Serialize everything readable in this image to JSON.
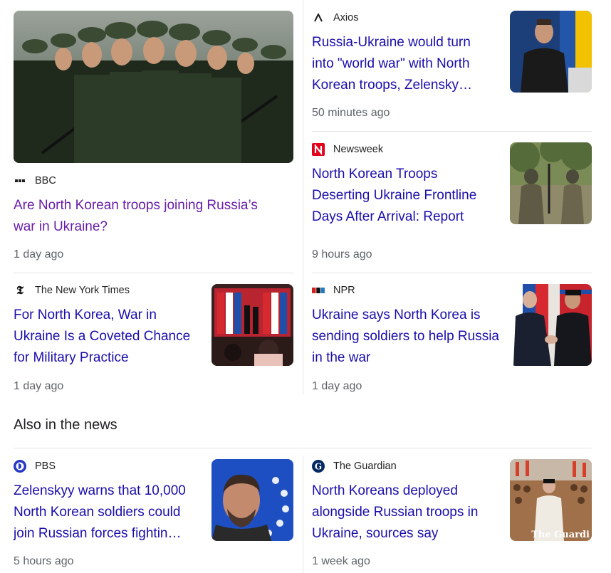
{
  "stories": [
    {
      "source": "BBC",
      "source_icon": "bbc-dots-icon",
      "headline": "Are North Korean troops joining Russia’s war in Ukraine?",
      "time": "1 day ago",
      "image": "soldiers-parade-image"
    },
    {
      "source": "Axios",
      "source_icon": "axios-logo-icon",
      "headline": "Russia-Ukraine would turn into \"world war\" with North Korean troops, Zelensky…",
      "time": "50 minutes ago",
      "image": "zelensky-podium-image"
    },
    {
      "source": "Newsweek",
      "source_icon": "newsweek-logo-icon",
      "headline": "North Korean Troops Deserting Ukraine Frontline Days After Arrival: Report",
      "time": "9 hours ago",
      "image": "soldiers-forest-image"
    },
    {
      "source": "The New York Times",
      "source_icon": "nyt-logo-icon",
      "headline": "For North Korea, War in Ukraine Is a Coveted Chance for Military Practice",
      "time": "1 day ago",
      "image": "flags-screen-image"
    },
    {
      "source": "NPR",
      "source_icon": "npr-logo-icon",
      "headline": "Ukraine says North Korea is sending soldiers to help Russia in the war",
      "time": "1 day ago",
      "image": "handshake-image"
    }
  ],
  "also_section": {
    "title": "Also in the news",
    "stories": [
      {
        "source": "PBS",
        "source_icon": "pbs-logo-icon",
        "headline": "Zelenskyy warns that 10,000 North Korean soldiers could join Russian forces fightin…",
        "time": "5 hours ago",
        "image": "zelenskyy-eu-image"
      },
      {
        "source": "The Guardian",
        "source_icon": "guardian-logo-icon",
        "headline": "North Koreans deployed alongside Russian troops in Ukraine, sources say",
        "time": "1 week ago",
        "image": "kim-crowd-image",
        "image_watermark": "The Guardi"
      }
    ]
  },
  "colors": {
    "link": "#1a0dab",
    "visited": "#681da8",
    "meta": "#5f6368"
  }
}
